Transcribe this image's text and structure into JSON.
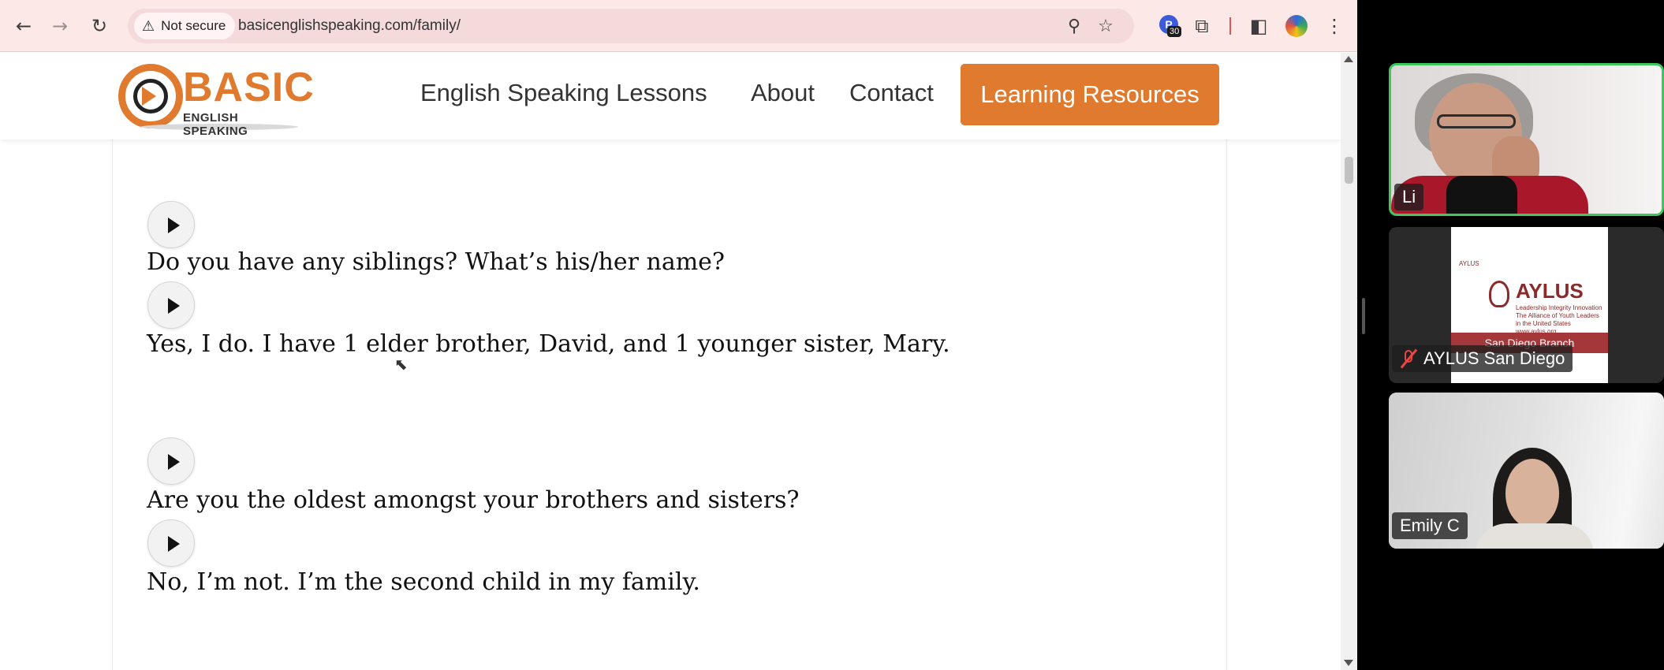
{
  "browser": {
    "not_secure_label": "Not secure",
    "url": "basicenglishspeaking.com/family/",
    "extension_badge_count": "30",
    "icons": [
      "back-icon",
      "forward-icon",
      "reload-icon",
      "warning-icon",
      "zoom-icon",
      "bookmark-star-icon",
      "extension-icon",
      "puzzle-icon",
      "side-panel-icon",
      "profile-icon",
      "more-menu-icon"
    ]
  },
  "site": {
    "logo_word": "BASIC",
    "logo_sub": "ENGLISH SPEAKING",
    "nav": {
      "lessons": "English Speaking Lessons",
      "about": "About",
      "contact": "Contact",
      "cta": "Learning Resources"
    },
    "accent_color": "#e07a2e"
  },
  "content": {
    "lines": [
      "Do you have any siblings? What’s his/her name?",
      "Yes, I do. I have 1 elder brother, David, and 1 younger sister, Mary.",
      "Are you the oldest amongst your brothers and sisters?",
      "No, I’m not. I’m the second child in my family."
    ]
  },
  "participants": [
    {
      "name": "Li",
      "active_speaker": true
    },
    {
      "name": "AYLUS San Diego",
      "muted": true
    },
    {
      "name": "Emily C"
    }
  ],
  "aylus_slide": {
    "small_label": "AYLUS",
    "brand": "AYLUS",
    "tagline": "Leadership Integrity Innovation The Alliance of Youth Leaders in the United States www.aylus.org",
    "band": "San Diego Branch",
    "brand_color": "#a3373a"
  }
}
